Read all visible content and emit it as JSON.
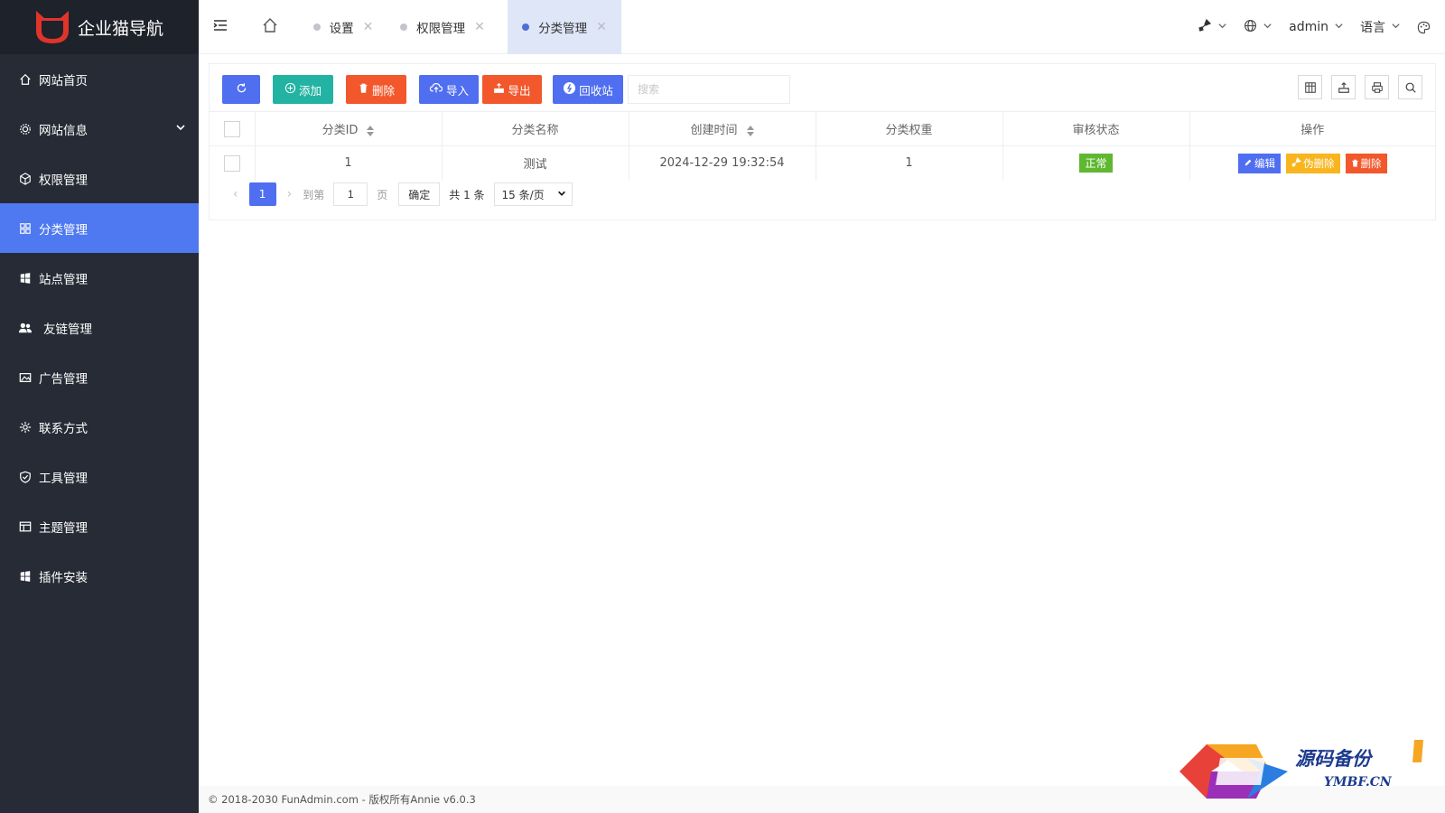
{
  "brand": {
    "title": "企业猫导航",
    "accent": "#4f79f0",
    "sidebar_bg": "#262b35"
  },
  "sidebar": {
    "items": [
      {
        "label": "网站首页",
        "icon": "home-icon"
      },
      {
        "label": "网站信息",
        "icon": "gear-icon",
        "expandable": true
      },
      {
        "label": "权限管理",
        "icon": "cube-icon"
      },
      {
        "label": "分类管理",
        "icon": "grid-icon",
        "active": true
      },
      {
        "label": "站点管理",
        "icon": "windows-icon"
      },
      {
        "label": "友链管理",
        "icon": "users-icon"
      },
      {
        "label": "广告管理",
        "icon": "image-icon"
      },
      {
        "label": "联系方式",
        "icon": "cog-icon"
      },
      {
        "label": "工具管理",
        "icon": "shield-icon"
      },
      {
        "label": "主题管理",
        "icon": "layout-icon"
      },
      {
        "label": "插件安装",
        "icon": "windows-icon"
      }
    ]
  },
  "header": {
    "tabs": [
      {
        "label": "设置",
        "active": false
      },
      {
        "label": "权限管理",
        "active": false
      },
      {
        "label": "分类管理",
        "active": true
      }
    ],
    "user": "admin",
    "language": "语言"
  },
  "toolbar": {
    "add": "添加",
    "delete": "删除",
    "import": "导入",
    "export": "导出",
    "recycle": "回收站",
    "search_placeholder": "搜索"
  },
  "table": {
    "columns": [
      "分类ID",
      "分类名称",
      "创建时间",
      "分类权重",
      "审核状态",
      "操作"
    ],
    "rows": [
      {
        "id": "1",
        "name": "测试",
        "created": "2024-12-29 19:32:54",
        "weight": "1",
        "status": "正常"
      }
    ],
    "actions": {
      "edit": "编辑",
      "fake_delete": "伪删除",
      "delete": "删除"
    }
  },
  "pager": {
    "current": "1",
    "goto_label": "到第",
    "goto_value": "1",
    "page_unit": "页",
    "confirm": "确定",
    "total": "共 1 条",
    "page_size": "15 条/页"
  },
  "footer": {
    "copyright": "© 2018-2030 FunAdmin.com - 版权所有Annie v6.0.3"
  },
  "watermark": {
    "cn": "源码备份",
    "en": "YMBF.CN"
  }
}
